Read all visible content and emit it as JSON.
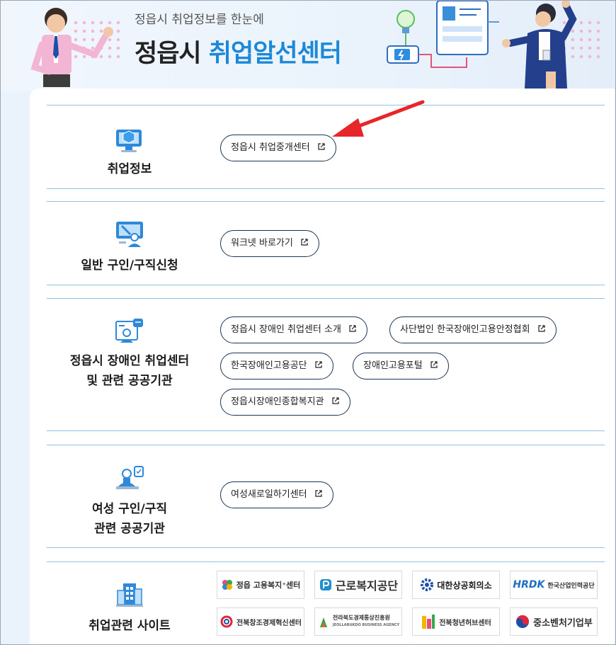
{
  "header": {
    "subtitle": "정읍시 취업정보를 한눈에",
    "title_prefix": "정읍시",
    "title_highlight": "취업알선센터"
  },
  "sections": [
    {
      "label": "취업정보",
      "icon": "monitor-cube-icon",
      "links": [
        {
          "label": "정읍시 취업중개센터"
        }
      ]
    },
    {
      "label": "일반 구인/구직신청",
      "icon": "person-monitor-icon",
      "links": [
        {
          "label": "워크넷 바로가기"
        }
      ]
    },
    {
      "label_line1": "정읍시 장애인 취업센터",
      "label_line2": "및 관련 공공기관",
      "icon": "person-chat-icon",
      "links": [
        {
          "label": "정읍시 장애인 취업센터 소개"
        },
        {
          "label": "사단법인 한국장애인고용안정협회"
        },
        {
          "label": "한국장애인고용공단"
        },
        {
          "label": "장애인고용포털"
        },
        {
          "label": "정읍시장애인종합복지관"
        }
      ]
    },
    {
      "label_line1": "여성 구인/구직",
      "label_line2": "관련 공공기관",
      "icon": "person-clipboard-icon",
      "links": [
        {
          "label": "여성새로일하기센터"
        }
      ]
    },
    {
      "label": "취업관련 사이트",
      "icon": "building-icon",
      "logos": [
        {
          "text": "정읍 고용복지⁺센터"
        },
        {
          "text": "근로복지공단"
        },
        {
          "text": "대한상공회의소"
        },
        {
          "mark": "HRDK",
          "text": "한국산업인력공단"
        },
        {
          "text": "전북창조경제혁신센터"
        },
        {
          "text": "전라북도경제통상진흥원",
          "sub": "JEOLLABUKDO BUSINESS AGENCY"
        },
        {
          "text": "전북청년허브센터"
        },
        {
          "text": "중소벤처기업부"
        }
      ]
    }
  ],
  "colors": {
    "accent": "#1e88d8",
    "divider": "#8fc4e6",
    "pill_border": "#1d3557",
    "arrow": "#e8262a"
  }
}
